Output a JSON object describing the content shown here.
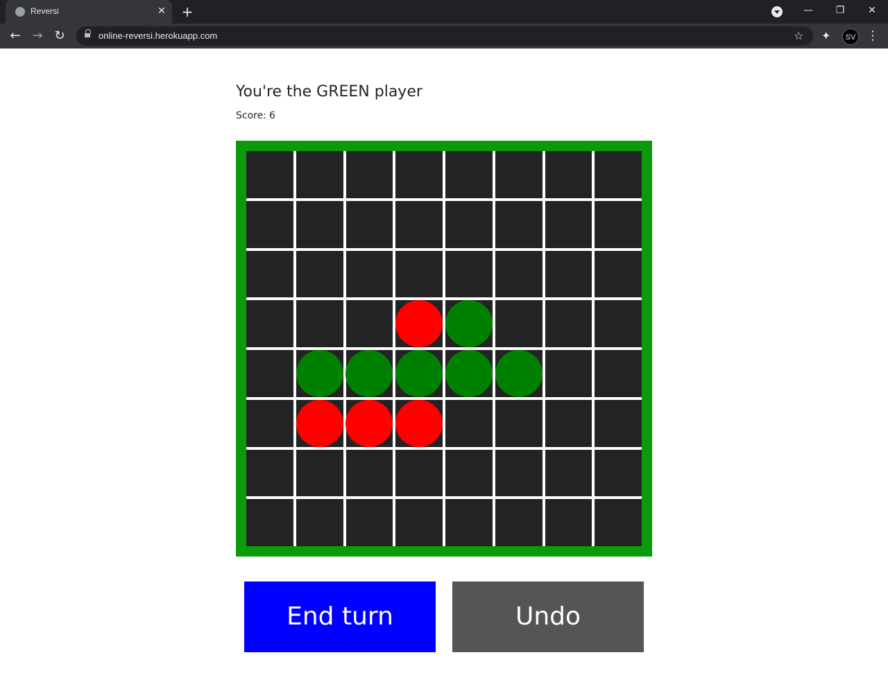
{
  "browser": {
    "tab_title": "Reversi",
    "url": "online-reversi.herokuapp.com",
    "profile_initials": "SV",
    "icons": {
      "favicon": "globe-icon",
      "close": "close-icon",
      "new_tab": "plus-icon",
      "back": "back-arrow-icon",
      "forward": "forward-arrow-icon",
      "reload": "reload-icon",
      "lock": "lock-icon",
      "bookmark": "star-icon",
      "extensions": "puzzle-icon",
      "menu": "kebab-menu-icon"
    }
  },
  "game": {
    "heading": "You're the GREEN player",
    "score_label": "Score:",
    "score_value": "6",
    "colors": {
      "frame": "#0a9a0a",
      "cell": "#232323",
      "grid_line": "#ffffff",
      "red_piece": "#ff0000",
      "green_piece": "#008000"
    },
    "board": [
      [
        "",
        "",
        "",
        "",
        "",
        "",
        "",
        ""
      ],
      [
        "",
        "",
        "",
        "",
        "",
        "",
        "",
        ""
      ],
      [
        "",
        "",
        "",
        "",
        "",
        "",
        "",
        ""
      ],
      [
        "",
        "",
        "",
        "red",
        "green",
        "",
        "",
        ""
      ],
      [
        "",
        "green",
        "green",
        "green",
        "green",
        "green",
        "",
        ""
      ],
      [
        "",
        "red",
        "red",
        "red",
        "",
        "",
        "",
        ""
      ],
      [
        "",
        "",
        "",
        "",
        "",
        "",
        "",
        ""
      ],
      [
        "",
        "",
        "",
        "",
        "",
        "",
        "",
        ""
      ]
    ]
  },
  "actions": {
    "end_turn_label": "End turn",
    "end_turn_color": "#0000ff",
    "undo_label": "Undo",
    "undo_color": "#555555"
  }
}
